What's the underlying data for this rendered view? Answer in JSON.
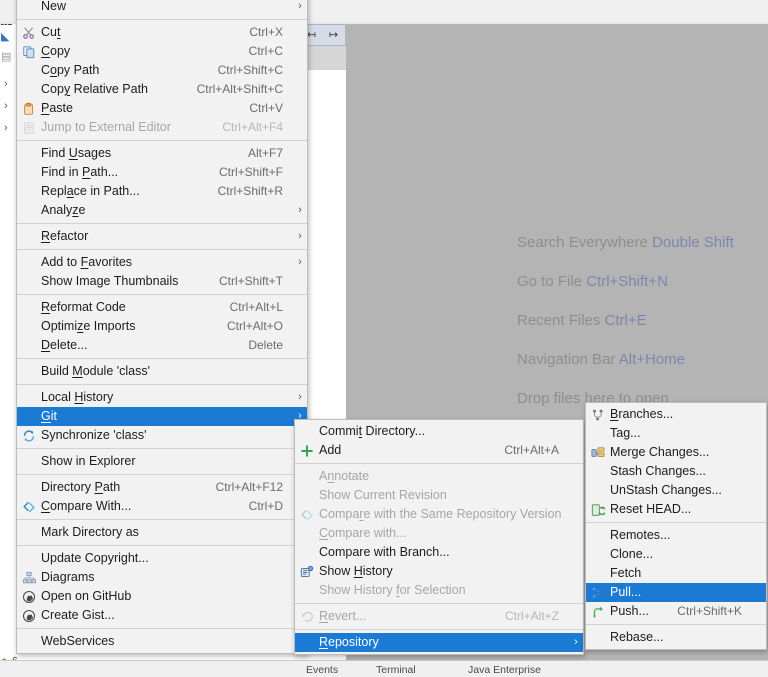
{
  "ide": {
    "hints": [
      {
        "label": "Search Everywhere",
        "shortcut": "Double Shift"
      },
      {
        "label": "Go to File",
        "shortcut": "Ctrl+Shift+N"
      },
      {
        "label": "Recent Files",
        "shortcut": "Ctrl+E"
      },
      {
        "label": "Navigation Bar",
        "shortcut": "Alt+Home"
      },
      {
        "label": "Drop files here to open",
        "shortcut": ""
      }
    ],
    "left_panel_fragment": "as",
    "status_items": [
      "6",
      "Events",
      "Terminal",
      "Java Enterprise"
    ],
    "colors": {
      "background": "#b4b4b4",
      "menu_background": "#f2f2f2",
      "selection": "#1a7ad4",
      "hint_text": "#8e8e8e",
      "hint_key": "#7d86ae"
    }
  },
  "context_menu": {
    "name": "project-context-menu",
    "items": [
      {
        "label": "New",
        "accel": "",
        "icon": "",
        "submenu": true,
        "disabled": false,
        "selected": false,
        "mnemonic": ""
      },
      {
        "sep": true
      },
      {
        "label": "Cut",
        "accel": "Ctrl+X",
        "icon": "scissors-icon",
        "submenu": false,
        "disabled": false,
        "selected": false,
        "mnemonic": "t"
      },
      {
        "label": "Copy",
        "accel": "Ctrl+C",
        "icon": "copy-icon",
        "submenu": false,
        "disabled": false,
        "selected": false,
        "mnemonic": "C"
      },
      {
        "label": "Copy Path",
        "accel": "Ctrl+Shift+C",
        "icon": "",
        "submenu": false,
        "disabled": false,
        "selected": false,
        "mnemonic": "o"
      },
      {
        "label": "Copy Relative Path",
        "accel": "Ctrl+Alt+Shift+C",
        "icon": "",
        "submenu": false,
        "disabled": false,
        "selected": false,
        "mnemonic": "y"
      },
      {
        "label": "Paste",
        "accel": "Ctrl+V",
        "icon": "paste-icon",
        "submenu": false,
        "disabled": false,
        "selected": false,
        "mnemonic": "P"
      },
      {
        "label": "Jump to External Editor",
        "accel": "Ctrl+Alt+F4",
        "icon": "external-editor-icon",
        "submenu": false,
        "disabled": true,
        "selected": false,
        "mnemonic": ""
      },
      {
        "sep": true
      },
      {
        "label": "Find Usages",
        "accel": "Alt+F7",
        "icon": "",
        "submenu": false,
        "disabled": false,
        "selected": false,
        "mnemonic": "U"
      },
      {
        "label": "Find in Path...",
        "accel": "Ctrl+Shift+F",
        "icon": "",
        "submenu": false,
        "disabled": false,
        "selected": false,
        "mnemonic": "P"
      },
      {
        "label": "Replace in Path...",
        "accel": "Ctrl+Shift+R",
        "icon": "",
        "submenu": false,
        "disabled": false,
        "selected": false,
        "mnemonic": "a"
      },
      {
        "label": "Analyze",
        "accel": "",
        "icon": "",
        "submenu": true,
        "disabled": false,
        "selected": false,
        "mnemonic": "z"
      },
      {
        "sep": true
      },
      {
        "label": "Refactor",
        "accel": "",
        "icon": "",
        "submenu": true,
        "disabled": false,
        "selected": false,
        "mnemonic": "R"
      },
      {
        "sep": true
      },
      {
        "label": "Add to Favorites",
        "accel": "",
        "icon": "",
        "submenu": true,
        "disabled": false,
        "selected": false,
        "mnemonic": "F"
      },
      {
        "label": "Show Image Thumbnails",
        "accel": "Ctrl+Shift+T",
        "icon": "",
        "submenu": false,
        "disabled": false,
        "selected": false,
        "mnemonic": ""
      },
      {
        "sep": true
      },
      {
        "label": "Reformat Code",
        "accel": "Ctrl+Alt+L",
        "icon": "",
        "submenu": false,
        "disabled": false,
        "selected": false,
        "mnemonic": "R"
      },
      {
        "label": "Optimize Imports",
        "accel": "Ctrl+Alt+O",
        "icon": "",
        "submenu": false,
        "disabled": false,
        "selected": false,
        "mnemonic": "z"
      },
      {
        "label": "Delete...",
        "accel": "Delete",
        "icon": "",
        "submenu": false,
        "disabled": false,
        "selected": false,
        "mnemonic": "D"
      },
      {
        "sep": true
      },
      {
        "label": "Build Module 'class'",
        "accel": "",
        "icon": "",
        "submenu": false,
        "disabled": false,
        "selected": false,
        "mnemonic": "M"
      },
      {
        "sep": true
      },
      {
        "label": "Local History",
        "accel": "",
        "icon": "",
        "submenu": true,
        "disabled": false,
        "selected": false,
        "mnemonic": "H"
      },
      {
        "label": "Git",
        "accel": "",
        "icon": "",
        "submenu": true,
        "disabled": false,
        "selected": true,
        "mnemonic": "G"
      },
      {
        "label": "Synchronize 'class'",
        "accel": "",
        "icon": "synchronize-icon",
        "submenu": false,
        "disabled": false,
        "selected": false,
        "mnemonic": ""
      },
      {
        "sep": true
      },
      {
        "label": "Show in Explorer",
        "accel": "",
        "icon": "",
        "submenu": false,
        "disabled": false,
        "selected": false,
        "mnemonic": ""
      },
      {
        "sep": true
      },
      {
        "label": "Directory Path",
        "accel": "Ctrl+Alt+F12",
        "icon": "",
        "submenu": false,
        "disabled": false,
        "selected": false,
        "mnemonic": "P"
      },
      {
        "label": "Compare With...",
        "accel": "Ctrl+D",
        "icon": "compare-icon",
        "submenu": false,
        "disabled": false,
        "selected": false,
        "mnemonic": "C"
      },
      {
        "sep": true
      },
      {
        "label": "Mark Directory as",
        "accel": "",
        "icon": "",
        "submenu": true,
        "disabled": false,
        "selected": false,
        "mnemonic": ""
      },
      {
        "sep": true
      },
      {
        "label": "Update Copyright...",
        "accel": "",
        "icon": "",
        "submenu": false,
        "disabled": false,
        "selected": false,
        "mnemonic": ""
      },
      {
        "label": "Diagrams",
        "accel": "",
        "icon": "diagrams-icon",
        "submenu": true,
        "disabled": false,
        "selected": false,
        "mnemonic": ""
      },
      {
        "label": "Open on GitHub",
        "accel": "",
        "icon": "github-icon",
        "submenu": false,
        "disabled": false,
        "selected": false,
        "mnemonic": ""
      },
      {
        "label": "Create Gist...",
        "accel": "",
        "icon": "github-icon",
        "submenu": false,
        "disabled": false,
        "selected": false,
        "mnemonic": ""
      },
      {
        "sep": true
      },
      {
        "label": "WebServices",
        "accel": "",
        "icon": "",
        "submenu": true,
        "disabled": false,
        "selected": false,
        "mnemonic": ""
      }
    ]
  },
  "git_menu": {
    "name": "git-submenu",
    "items": [
      {
        "label": "Commit Directory...",
        "accel": "",
        "icon": "",
        "submenu": false,
        "disabled": false,
        "selected": false,
        "mnemonic": "t"
      },
      {
        "label": "Add",
        "accel": "Ctrl+Alt+A",
        "icon": "plus-icon",
        "submenu": false,
        "disabled": false,
        "selected": false,
        "mnemonic": ""
      },
      {
        "sep": true
      },
      {
        "label": "Annotate",
        "accel": "",
        "icon": "",
        "submenu": false,
        "disabled": true,
        "selected": false,
        "mnemonic": "n"
      },
      {
        "label": "Show Current Revision",
        "accel": "",
        "icon": "",
        "submenu": false,
        "disabled": true,
        "selected": false,
        "mnemonic": ""
      },
      {
        "label": "Compare with the Same Repository Version",
        "accel": "",
        "icon": "compare-icon",
        "submenu": false,
        "disabled": true,
        "selected": false,
        "mnemonic": "r"
      },
      {
        "label": "Compare with...",
        "accel": "",
        "icon": "",
        "submenu": false,
        "disabled": true,
        "selected": false,
        "mnemonic": "C"
      },
      {
        "label": "Compare with Branch...",
        "accel": "",
        "icon": "",
        "submenu": false,
        "disabled": false,
        "selected": false,
        "mnemonic": ""
      },
      {
        "label": "Show History",
        "accel": "",
        "icon": "show-history-icon",
        "submenu": false,
        "disabled": false,
        "selected": false,
        "mnemonic": "H"
      },
      {
        "label": "Show History for Selection",
        "accel": "",
        "icon": "",
        "submenu": false,
        "disabled": true,
        "selected": false,
        "mnemonic": "f"
      },
      {
        "sep": true
      },
      {
        "label": "Revert...",
        "accel": "Ctrl+Alt+Z",
        "icon": "revert-icon",
        "submenu": false,
        "disabled": true,
        "selected": false,
        "mnemonic": "R"
      },
      {
        "sep": true
      },
      {
        "label": "Repository",
        "accel": "",
        "icon": "",
        "submenu": true,
        "disabled": false,
        "selected": true,
        "mnemonic": "R"
      }
    ]
  },
  "repository_menu": {
    "name": "repository-submenu",
    "items": [
      {
        "label": "Branches...",
        "accel": "",
        "icon": "branches-icon",
        "submenu": false,
        "disabled": false,
        "selected": false,
        "mnemonic": "B"
      },
      {
        "label": "Tag...",
        "accel": "",
        "icon": "",
        "submenu": false,
        "disabled": false,
        "selected": false,
        "mnemonic": ""
      },
      {
        "label": "Merge Changes...",
        "accel": "",
        "icon": "merge-icon",
        "submenu": false,
        "disabled": false,
        "selected": false,
        "mnemonic": ""
      },
      {
        "label": "Stash Changes...",
        "accel": "",
        "icon": "",
        "submenu": false,
        "disabled": false,
        "selected": false,
        "mnemonic": ""
      },
      {
        "label": "UnStash Changes...",
        "accel": "",
        "icon": "",
        "submenu": false,
        "disabled": false,
        "selected": false,
        "mnemonic": ""
      },
      {
        "label": "Reset HEAD...",
        "accel": "",
        "icon": "reset-head-icon",
        "submenu": false,
        "disabled": false,
        "selected": false,
        "mnemonic": ""
      },
      {
        "sep": true
      },
      {
        "label": "Remotes...",
        "accel": "",
        "icon": "",
        "submenu": false,
        "disabled": false,
        "selected": false,
        "mnemonic": ""
      },
      {
        "label": "Clone...",
        "accel": "",
        "icon": "",
        "submenu": false,
        "disabled": false,
        "selected": false,
        "mnemonic": ""
      },
      {
        "label": "Fetch",
        "accel": "",
        "icon": "",
        "submenu": false,
        "disabled": false,
        "selected": false,
        "mnemonic": ""
      },
      {
        "label": "Pull...",
        "accel": "",
        "icon": "pull-icon",
        "submenu": false,
        "disabled": false,
        "selected": true,
        "mnemonic": ""
      },
      {
        "label": "Push...",
        "accel": "Ctrl+Shift+K",
        "icon": "push-icon",
        "submenu": false,
        "disabled": false,
        "selected": false,
        "mnemonic": ""
      },
      {
        "sep": true
      },
      {
        "label": "Rebase...",
        "accel": "",
        "icon": "",
        "submenu": false,
        "disabled": false,
        "selected": false,
        "mnemonic": ""
      }
    ]
  }
}
